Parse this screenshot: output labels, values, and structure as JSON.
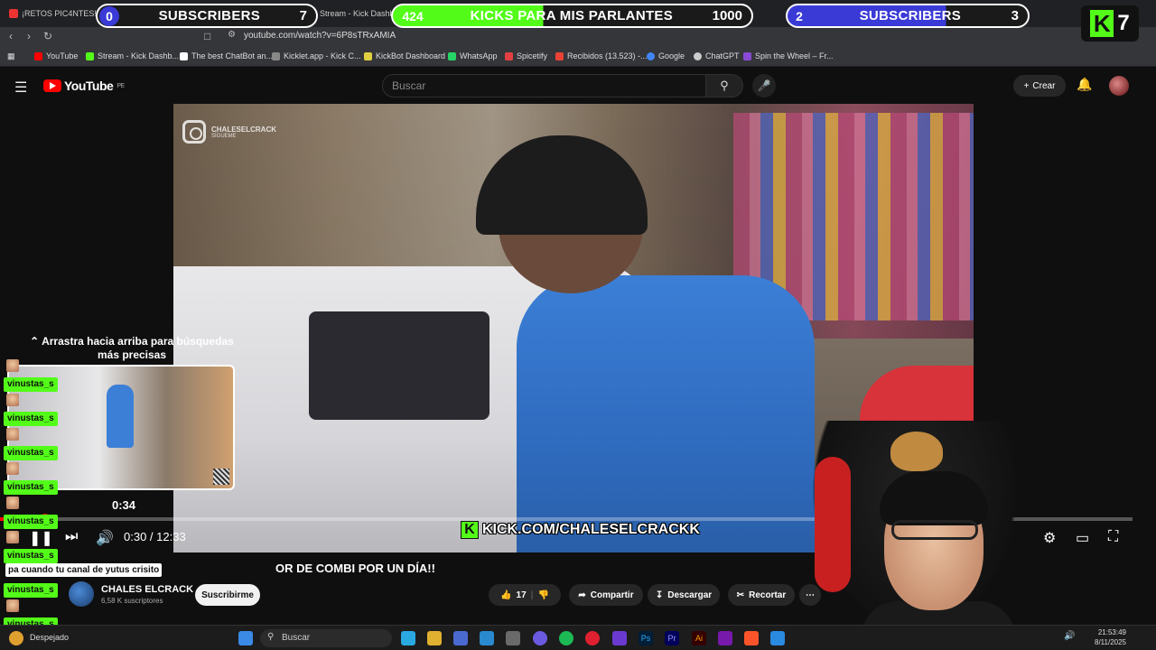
{
  "browser": {
    "tabs": [
      {
        "label": "¡RETOS PIC4NTES!"
      },
      {
        "label": "Stream - Kick Dashboa"
      }
    ],
    "url": "youtube.com/watch?v=6P8sTRxAMIA",
    "bookmarks": [
      {
        "label": "YouTube",
        "color": "#ff0000"
      },
      {
        "label": "Stream - Kick Dashb...",
        "color": "#53fc18"
      },
      {
        "label": "The best ChatBot an...",
        "color": "#ffffff"
      },
      {
        "label": "Kicklet.app - Kick C...",
        "color": "#888888"
      },
      {
        "label": "KickBot Dashboard",
        "color": "#e0d040"
      },
      {
        "label": "WhatsApp",
        "color": "#25d366"
      },
      {
        "label": "Spicetify",
        "color": "#e04040"
      },
      {
        "label": "Recibidos (13.523) -...",
        "color": "#ea4335"
      },
      {
        "label": "Google",
        "color": "#4285f4"
      },
      {
        "label": "ChatGPT",
        "color": "#cccccc"
      },
      {
        "label": "Spin the Wheel – Fr...",
        "color": "#8a4ad6"
      }
    ]
  },
  "overlay": {
    "goal_left": {
      "current": "0",
      "label": "SUBSCRIBERS",
      "target": "7",
      "color": "#3a3ad6"
    },
    "goal_mid": {
      "current": "424",
      "label": "KICKS PARA MIS PARLANTES",
      "target": "1000",
      "color": "#53fc18"
    },
    "goal_right": {
      "current": "2",
      "label": "SUBSCRIBERS",
      "target": "3",
      "color": "#3a3ad6"
    },
    "kick_badge": {
      "letter": "K",
      "count": "7"
    }
  },
  "youtube": {
    "logo_text": "YouTube",
    "region": "PE",
    "search_placeholder": "Buscar",
    "create_label": "Crear"
  },
  "video": {
    "ig_handle": "CHALESELCRACK",
    "ig_sub": "SÍGUEME",
    "kick_url": "KICK.COM/CHALESELCRACKK",
    "swipe_hint": "Arrastra hacia arriba para búsquedas más precisas",
    "preview_time": "0:34",
    "current_time": "0:30",
    "duration": "12:33",
    "progress_fraction": 0.04
  },
  "watch": {
    "title": "OR DE COMBI POR UN DÍA!!",
    "channel_name": "CHALES ELCRACK",
    "channel_subs": "6,58 K suscriptores",
    "subscribe_label": "Suscribirme",
    "likes": "17",
    "share_label": "Compartir",
    "download_label": "Descargar",
    "clip_label": "Recortar"
  },
  "chat": {
    "username": "vinustas_s",
    "message": "pa cuando tu canal de yutus crisito"
  },
  "taskbar": {
    "weather": "Despejado",
    "search_label": "Buscar",
    "time": "21:53:49",
    "date": "8/11/2025"
  }
}
